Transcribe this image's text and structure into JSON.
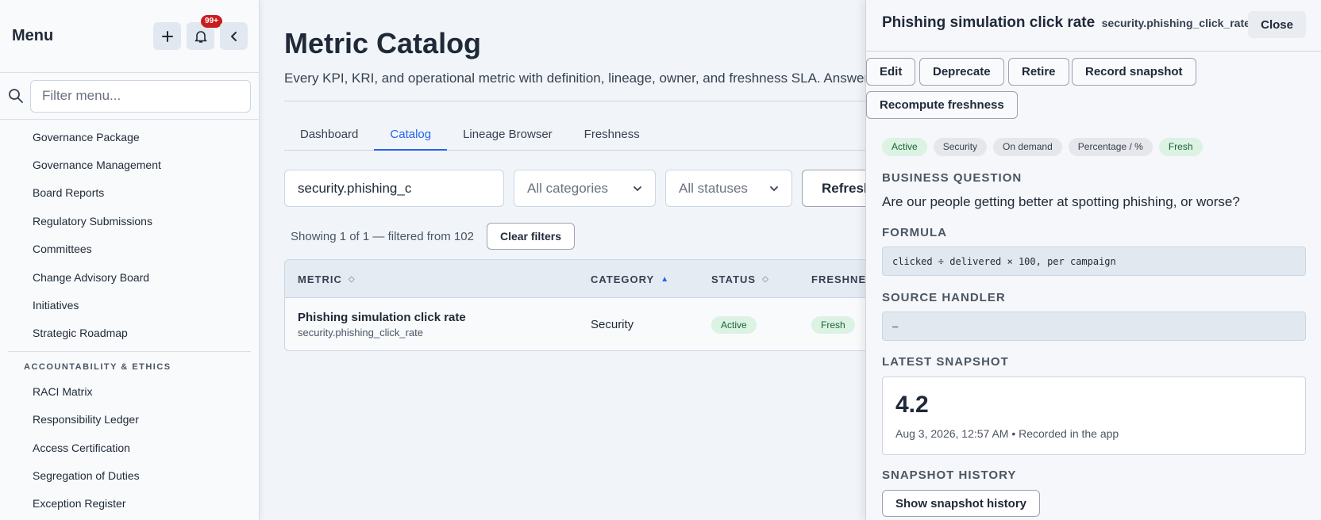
{
  "sidebar": {
    "title": "Menu",
    "notification_badge": "99+",
    "search_placeholder": "Filter menu...",
    "items_group1": [
      "Governance Package",
      "Governance Management",
      "Board Reports",
      "Regulatory Submissions",
      "Committees",
      "Change Advisory Board",
      "Initiatives",
      "Strategic Roadmap"
    ],
    "section_accountability": "ACCOUNTABILITY & ETHICS",
    "items_group2": [
      "RACI Matrix",
      "Responsibility Ledger",
      "Access Certification",
      "Segregation of Duties",
      "Exception Register"
    ]
  },
  "main": {
    "title": "Metric Catalog",
    "description": "Every KPI, KRI, and operational metric with definition, lineage, owner, and freshness SLA. Answer",
    "tabs": [
      "Dashboard",
      "Catalog",
      "Lineage Browser",
      "Freshness"
    ],
    "active_tab": "Catalog",
    "search_value": "security.phishing_c",
    "category_select": "All categories",
    "status_select": "All statuses",
    "refresh_label": "Refresh",
    "showing_text": "Showing 1 of 1 — filtered from 102",
    "clear_filters_label": "Clear filters",
    "table": {
      "columns": [
        "METRIC",
        "CATEGORY",
        "STATUS",
        "FRESHNESS"
      ],
      "rows": [
        {
          "name": "Phishing simulation click rate",
          "key": "security.phishing_click_rate",
          "category": "Security",
          "status": "Active",
          "freshness": "Fresh"
        }
      ]
    }
  },
  "panel": {
    "title": "Phishing simulation click rate",
    "key": "security.phishing_click_rate",
    "close_label": "Close",
    "actions": [
      "Edit",
      "Deprecate",
      "Retire",
      "Record snapshot",
      "Recompute freshness"
    ],
    "tags": [
      "Active",
      "Security",
      "On demand",
      "Percentage / %",
      "Fresh"
    ],
    "business_question_label": "BUSINESS QUESTION",
    "business_question": "Are our people getting better at spotting phishing, or worse?",
    "formula_label": "FORMULA",
    "formula": "clicked ÷ delivered × 100, per campaign",
    "source_handler_label": "SOURCE HANDLER",
    "source_handler": "—",
    "latest_snapshot_label": "LATEST SNAPSHOT",
    "latest_snapshot_value": "4.2",
    "latest_snapshot_meta": "Aug 3, 2026, 12:57 AM • Recorded in the app",
    "snapshot_history_label": "SNAPSHOT HISTORY",
    "show_history_label": "Show snapshot history"
  }
}
